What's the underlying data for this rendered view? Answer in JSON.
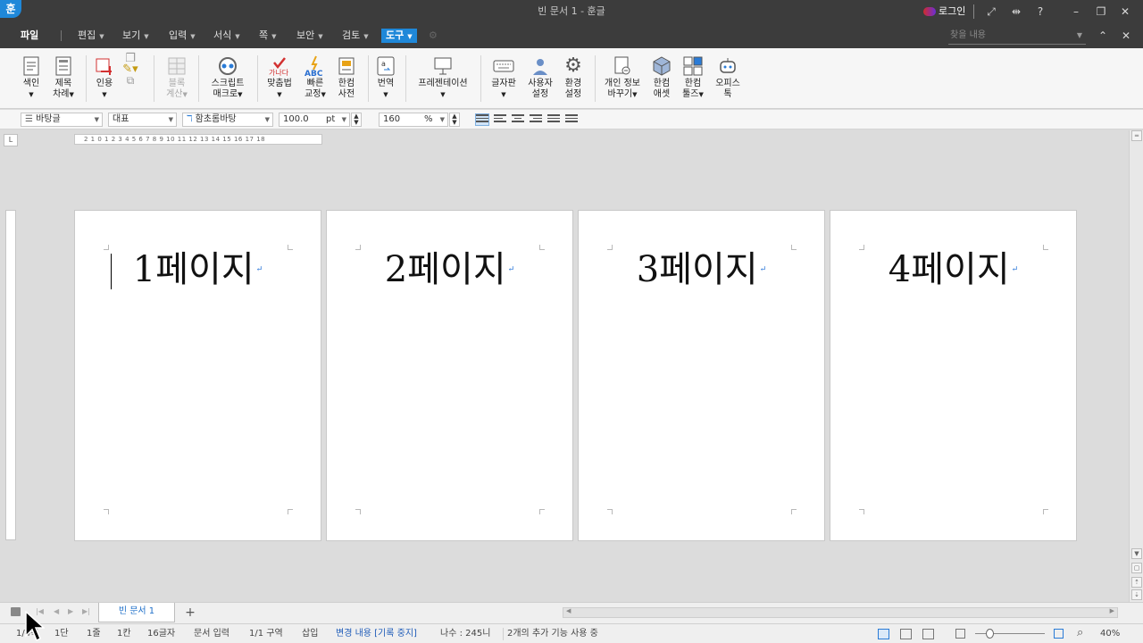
{
  "titlebar": {
    "logo": "훈",
    "title": "빈 문서 1 - 훈글",
    "login": "로그인",
    "icons": [
      "fullscreen-icon",
      "resize-icon",
      "help-icon",
      "minimize-icon",
      "restore-icon",
      "close-icon"
    ]
  },
  "menubar": {
    "items": [
      {
        "label": "파일"
      },
      {
        "label": "편집"
      },
      {
        "label": "보기"
      },
      {
        "label": "입력"
      },
      {
        "label": "서식"
      },
      {
        "label": "쪽"
      },
      {
        "label": "보안"
      },
      {
        "label": "검토"
      },
      {
        "label": "도구"
      }
    ],
    "search_placeholder": "찾을 내용"
  },
  "ribbon": {
    "buttons": [
      {
        "line1": "색인",
        "line2": "",
        "caret": true
      },
      {
        "line1": "제목",
        "line2": "차례",
        "caret": true
      },
      {
        "line1": "인용",
        "line2": "",
        "caret": true
      },
      {
        "line1": "블록",
        "line2": "계산",
        "caret": true,
        "disabled": true
      },
      {
        "line1": "스크립트",
        "line2": "매크로",
        "caret": true
      },
      {
        "line1": "맞춤법",
        "line2": "",
        "caret": true
      },
      {
        "line1": "빠른",
        "line2": "교정",
        "caret": true
      },
      {
        "line1": "한컴",
        "line2": "사전",
        "caret": false
      },
      {
        "line1": "번역",
        "line2": "",
        "caret": true
      },
      {
        "line1": "프레젠테이션",
        "line2": "",
        "caret": true
      },
      {
        "line1": "글자판",
        "line2": "",
        "caret": true
      },
      {
        "line1": "사용자",
        "line2": "설정",
        "caret": false
      },
      {
        "line1": "환경",
        "line2": "설정",
        "caret": false
      },
      {
        "line1": "개인 정보",
        "line2": "바꾸기",
        "caret": true
      },
      {
        "line1": "한컴",
        "line2": "애셋",
        "caret": false
      },
      {
        "line1": "한컴",
        "line2": "툴즈",
        "caret": true
      },
      {
        "line1": "오피스",
        "line2": "톡",
        "caret": false
      }
    ],
    "spell_icon_text": "가나다",
    "abc_icon_text": "ABC"
  },
  "format": {
    "style": "바탕글",
    "lang": "대표",
    "font": "함초롬바탕",
    "size": "100.0",
    "size_unit": "pt",
    "line_spacing": "160",
    "line_spacing_unit": "%"
  },
  "ruler": {
    "corner": "L",
    "marks": "2 1 0 1 2 3 4 5 6 7 8 9 10 11 12 13 14 15 16 17 18"
  },
  "pages": [
    {
      "text": "1페이지"
    },
    {
      "text": "2페이지"
    },
    {
      "text": "3페이지"
    },
    {
      "text": "4페이지"
    }
  ],
  "para_mark": "↵",
  "tabbar": {
    "doc_tab": "빈 문서 1",
    "add": "+"
  },
  "statusbar": {
    "page": "1/4쪽",
    "section": "1단",
    "line": "1줄",
    "col": "1칸",
    "chars": "16글자",
    "mode": "문서 입력",
    "area": "1/1 구역",
    "insert": "삽입",
    "track": "변경 내용 [기록 중지]",
    "dir": "나수 : 245니",
    "addon": "2개의 추가 기능 사용 중",
    "zoom": "40%"
  },
  "colors": {
    "accent": "#1f88d9",
    "titlebar": "#3c3c3c",
    "workspace": "#dcdcdc"
  }
}
